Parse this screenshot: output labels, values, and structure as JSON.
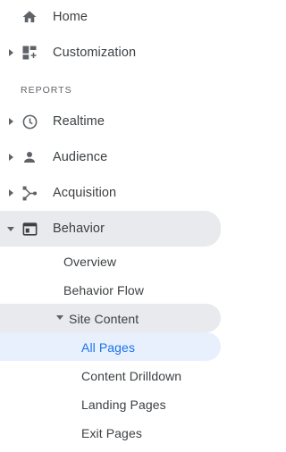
{
  "nav": {
    "home": {
      "label": "Home",
      "icon": "home-icon"
    },
    "customization": {
      "label": "Customization",
      "icon": "dashboard-plus-icon"
    },
    "reports_header": "REPORTS",
    "realtime": {
      "label": "Realtime",
      "icon": "clock-icon"
    },
    "audience": {
      "label": "Audience",
      "icon": "person-icon"
    },
    "acquisition": {
      "label": "Acquisition",
      "icon": "acquisition-icon"
    },
    "behavior": {
      "label": "Behavior",
      "icon": "browser-window-icon",
      "children": {
        "overview": "Overview",
        "behavior_flow": "Behavior Flow",
        "site_content": {
          "label": "Site Content",
          "children": {
            "all_pages": "All Pages",
            "content_drilldown": "Content Drilldown",
            "landing_pages": "Landing Pages",
            "exit_pages": "Exit Pages"
          }
        }
      }
    }
  },
  "colors": {
    "text": "#3c4043",
    "icon": "#5f6368",
    "selected_section_bg": "#e8eaed",
    "active_item_bg": "#e8f0fe",
    "active_item_text": "#1a73e8"
  }
}
